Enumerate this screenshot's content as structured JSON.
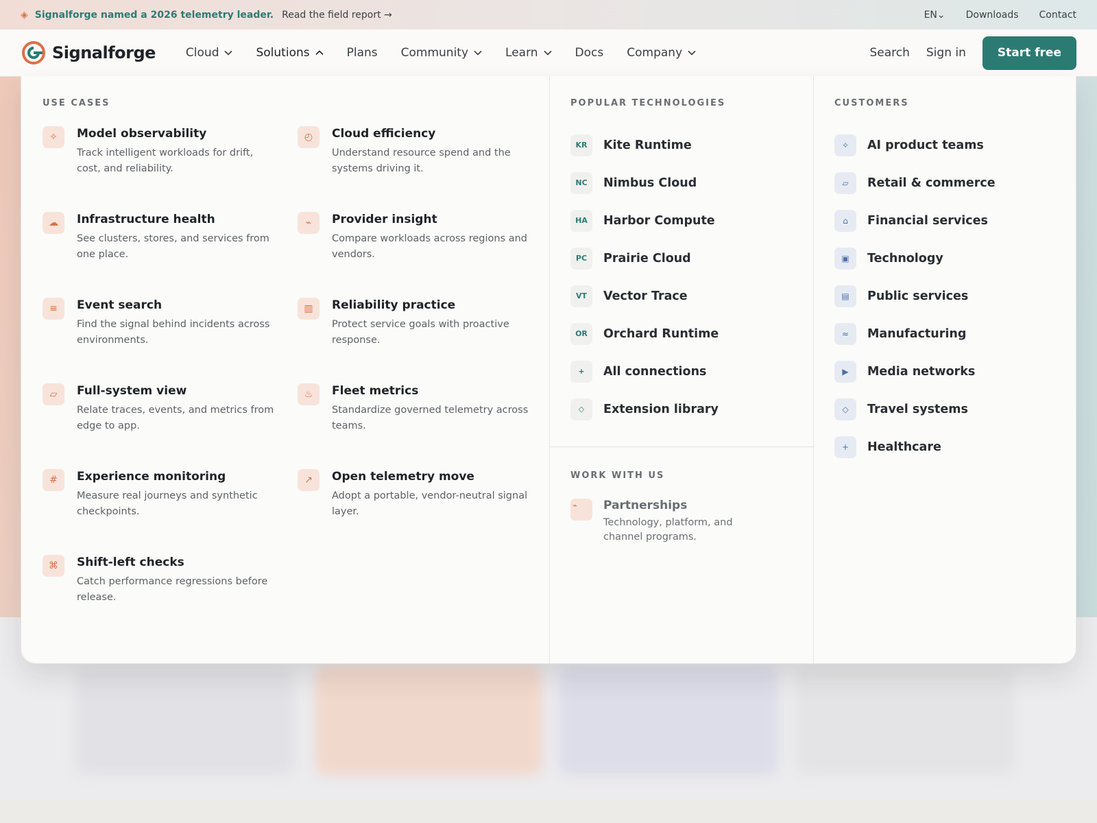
{
  "colors": {
    "brand": "#2c7b72",
    "accent": "#d9714a",
    "customer_icon": "#4d6fa8"
  },
  "announcement": {
    "icon": "diamond-icon",
    "headline": "Signalforge named a 2026 telemetry leader.",
    "link": "Read the field report →",
    "language": "EN⌄",
    "downloads": "Downloads",
    "contact": "Contact"
  },
  "nav": {
    "brand": "Signalforge",
    "items": [
      {
        "label": "Cloud",
        "chevron": "down"
      },
      {
        "label": "Solutions",
        "chevron": "up"
      },
      {
        "label": "Plans"
      },
      {
        "label": "Community",
        "chevron": "down"
      },
      {
        "label": "Learn",
        "chevron": "down"
      },
      {
        "label": "Docs"
      },
      {
        "label": "Company",
        "chevron": "down"
      }
    ],
    "search": "Search",
    "sign_in": "Sign in",
    "cta": "Start free"
  },
  "dropdown": {
    "use_cases": {
      "heading": "USE CASES",
      "items": [
        {
          "icon": "sparkle-icon",
          "glyph": "✧",
          "title": "Model observability",
          "desc": "Track intelligent workloads for drift, cost, and reliability."
        },
        {
          "icon": "gauge-icon",
          "glyph": "◴",
          "title": "Cloud efficiency",
          "desc": "Understand resource spend and the systems driving it."
        },
        {
          "icon": "cloud-icon",
          "glyph": "☁",
          "title": "Infrastructure health",
          "desc": "See clusters, stores, and services from one place."
        },
        {
          "icon": "pulse-icon",
          "glyph": "⌁",
          "title": "Provider insight",
          "desc": "Compare workloads across regions and vendors."
        },
        {
          "icon": "list-icon",
          "glyph": "≡",
          "title": "Event search",
          "desc": "Find the signal behind incidents across environments."
        },
        {
          "icon": "bars-icon",
          "glyph": "▥",
          "title": "Reliability practice",
          "desc": "Protect service goals with proactive response."
        },
        {
          "icon": "window-icon",
          "glyph": "▱",
          "title": "Full-system view",
          "desc": "Relate traces, events, and metrics from edge to app."
        },
        {
          "icon": "heat-icon",
          "glyph": "♨",
          "title": "Fleet metrics",
          "desc": "Standardize governed telemetry across teams."
        },
        {
          "icon": "hash-icon",
          "glyph": "#",
          "title": "Experience monitoring",
          "desc": "Measure real journeys and synthetic checkpoints."
        },
        {
          "icon": "arrow-up-right-icon",
          "glyph": "↗",
          "title": "Open telemetry move",
          "desc": "Adopt a portable, vendor-neutral signal layer."
        },
        {
          "icon": "command-icon",
          "glyph": "⌘",
          "title": "Shift-left checks",
          "desc": "Catch performance regressions before release."
        }
      ]
    },
    "technologies": {
      "heading": "POPULAR TECHNOLOGIES",
      "items": [
        {
          "badge": "KR",
          "name": "Kite Runtime"
        },
        {
          "badge": "NC",
          "name": "Nimbus Cloud"
        },
        {
          "badge": "HA",
          "name": "Harbor Compute"
        },
        {
          "badge": "PC",
          "name": "Prairie Cloud"
        },
        {
          "badge": "VT",
          "name": "Vector Trace"
        },
        {
          "badge": "OR",
          "name": "Orchard Runtime"
        },
        {
          "badge": "+",
          "name": "All connections"
        },
        {
          "badge": "◇",
          "name": "Extension library"
        }
      ]
    },
    "work_with_us": {
      "heading": "WORK WITH US",
      "title": "Partnerships",
      "desc": "Technology, platform, and channel programs."
    },
    "customers": {
      "heading": "CUSTOMERS",
      "items": [
        {
          "icon": "sparkle-icon",
          "glyph": "✧",
          "name": "AI product teams"
        },
        {
          "icon": "tag-icon",
          "glyph": "▱",
          "name": "Retail & commerce"
        },
        {
          "icon": "bank-icon",
          "glyph": "⌂",
          "name": "Financial services"
        },
        {
          "icon": "chip-icon",
          "glyph": "▣",
          "name": "Technology"
        },
        {
          "icon": "building-icon",
          "glyph": "▤",
          "name": "Public services"
        },
        {
          "icon": "wave-icon",
          "glyph": "≈",
          "name": "Manufacturing"
        },
        {
          "icon": "play-icon",
          "glyph": "▶",
          "name": "Media networks"
        },
        {
          "icon": "diamond-icon",
          "glyph": "◇",
          "name": "Travel systems"
        },
        {
          "icon": "plus-icon",
          "glyph": "+",
          "name": "Healthcare"
        }
      ]
    }
  }
}
